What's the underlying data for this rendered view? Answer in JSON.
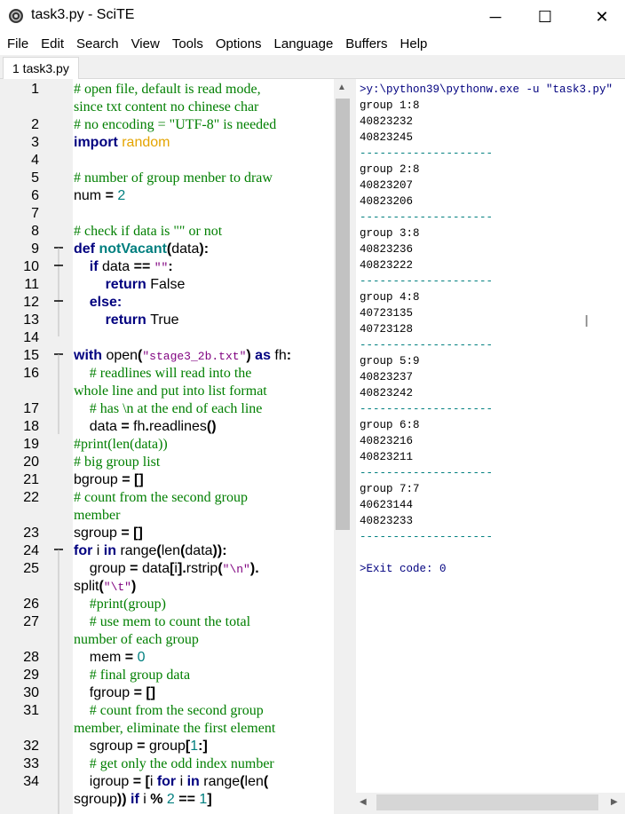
{
  "window": {
    "title": "task3.py - SciTE",
    "icon": "scite-app-icon",
    "controls": {
      "minimize": "─",
      "maximize": "☐",
      "close": "✕"
    }
  },
  "menu": [
    "File",
    "Edit",
    "Search",
    "View",
    "Tools",
    "Options",
    "Language",
    "Buffers",
    "Help"
  ],
  "tabs": [
    {
      "label": "1 task3.py",
      "active": true
    }
  ],
  "editor": {
    "line_numbers": [
      "1",
      "2",
      "3",
      "4",
      "5",
      "6",
      "7",
      "8",
      "9",
      "10",
      "11",
      "12",
      "13",
      "14",
      "15",
      "16",
      "17",
      "18",
      "19",
      "20",
      "21",
      "22",
      "23",
      "24",
      "25",
      "26",
      "27",
      "28",
      "29",
      "30",
      "31",
      "32",
      "33",
      "34"
    ],
    "lines": [
      [
        [
          "cm",
          "# open file, default is read mode,"
        ]
      ],
      [
        [
          "cm",
          "since txt content no chinese char"
        ]
      ],
      [
        [
          "cm",
          "# no encoding = \"UTF-8\" is needed"
        ]
      ],
      [
        [
          "kw",
          "import "
        ],
        [
          "imp",
          "random"
        ]
      ],
      [],
      [
        [
          "cm",
          "# number of group menber to draw"
        ]
      ],
      [
        [
          "id",
          "num "
        ],
        [
          "op",
          "= "
        ],
        [
          "num",
          "2"
        ]
      ],
      [],
      [
        [
          "cm",
          "# check if data is \"\" or not"
        ]
      ],
      [
        [
          "kw",
          "def "
        ],
        [
          "fn",
          "notVacant"
        ],
        [
          "op",
          "("
        ],
        [
          "id",
          "data"
        ],
        [
          "op",
          "):"
        ]
      ],
      [
        [
          "id",
          "    "
        ],
        [
          "kw",
          "if "
        ],
        [
          "id",
          "data "
        ],
        [
          "op",
          "== "
        ],
        [
          "str",
          "\"\""
        ],
        [
          "op",
          ":"
        ]
      ],
      [
        [
          "id",
          "        "
        ],
        [
          "kw",
          "return "
        ],
        [
          "id",
          "False"
        ]
      ],
      [
        [
          "id",
          "    "
        ],
        [
          "kw",
          "else:"
        ]
      ],
      [
        [
          "id",
          "        "
        ],
        [
          "kw",
          "return "
        ],
        [
          "id",
          "True"
        ]
      ],
      [],
      [
        [
          "kw",
          "with "
        ],
        [
          "id",
          "open"
        ],
        [
          "op",
          "("
        ],
        [
          "str",
          "\"stage3_2b.txt\""
        ],
        [
          "op",
          ") "
        ],
        [
          "kw",
          "as "
        ],
        [
          "id",
          "fh"
        ],
        [
          "op",
          ":"
        ]
      ],
      [
        [
          "id",
          "    "
        ],
        [
          "cm",
          "# readlines will read into the"
        ]
      ],
      [
        [
          "cm",
          "whole line and put into list format"
        ]
      ],
      [
        [
          "id",
          "    "
        ],
        [
          "cm",
          "# has \\n at the end of each line"
        ]
      ],
      [
        [
          "id",
          "    data "
        ],
        [
          "op",
          "= "
        ],
        [
          "id",
          "fh"
        ],
        [
          "op",
          "."
        ],
        [
          "id",
          "readlines"
        ],
        [
          "op",
          "()"
        ]
      ],
      [
        [
          "cm",
          "#print(len(data))"
        ]
      ],
      [
        [
          "cm",
          "# big group list"
        ]
      ],
      [
        [
          "id",
          "bgroup "
        ],
        [
          "op",
          "= []"
        ]
      ],
      [
        [
          "cm",
          "# count from the second group"
        ]
      ],
      [
        [
          "cm",
          "member"
        ]
      ],
      [
        [
          "id",
          "sgroup "
        ],
        [
          "op",
          "= []"
        ]
      ],
      [
        [
          "kw",
          "for "
        ],
        [
          "id",
          "i "
        ],
        [
          "kw",
          "in "
        ],
        [
          "id",
          "range"
        ],
        [
          "op",
          "("
        ],
        [
          "id",
          "len"
        ],
        [
          "op",
          "("
        ],
        [
          "id",
          "data"
        ],
        [
          "op",
          "))"
        ],
        [
          "op",
          ":"
        ]
      ],
      [
        [
          "id",
          "    group "
        ],
        [
          "op",
          "= "
        ],
        [
          "id",
          "data"
        ],
        [
          "op",
          "["
        ],
        [
          "id",
          "i"
        ],
        [
          "op",
          "]."
        ],
        [
          "id",
          "rstrip"
        ],
        [
          "op",
          "("
        ],
        [
          "str",
          "\"\\n\""
        ],
        [
          "op",
          ")."
        ]
      ],
      [
        [
          "id",
          "split"
        ],
        [
          "op",
          "("
        ],
        [
          "str",
          "\"\\t\""
        ],
        [
          "op",
          ")"
        ]
      ],
      [
        [
          "id",
          "    "
        ],
        [
          "cm",
          "#print(group)"
        ]
      ],
      [
        [
          "id",
          "    "
        ],
        [
          "cm",
          "# use mem to count the total"
        ]
      ],
      [
        [
          "cm",
          "number of each group"
        ]
      ],
      [
        [
          "id",
          "    mem "
        ],
        [
          "op",
          "= "
        ],
        [
          "num",
          "0"
        ]
      ],
      [
        [
          "id",
          "    "
        ],
        [
          "cm",
          "# final group data"
        ]
      ],
      [
        [
          "id",
          "    fgroup "
        ],
        [
          "op",
          "= []"
        ]
      ],
      [
        [
          "id",
          "    "
        ],
        [
          "cm",
          "# count from the second group"
        ]
      ],
      [
        [
          "cm",
          "member, eliminate the first element"
        ]
      ],
      [
        [
          "id",
          "    sgroup "
        ],
        [
          "op",
          "= "
        ],
        [
          "id",
          "group"
        ],
        [
          "op",
          "["
        ],
        [
          "num",
          "1"
        ],
        [
          "op",
          ":]"
        ]
      ],
      [
        [
          "id",
          "    "
        ],
        [
          "cm",
          "# get only the odd index number"
        ]
      ],
      [
        [
          "id",
          "    igroup "
        ],
        [
          "op",
          "= ["
        ],
        [
          "id",
          "i "
        ],
        [
          "kw",
          "for "
        ],
        [
          "id",
          "i "
        ],
        [
          "kw",
          "in "
        ],
        [
          "id",
          "range"
        ],
        [
          "op",
          "("
        ],
        [
          "id",
          "len"
        ],
        [
          "op",
          "("
        ]
      ],
      [
        [
          "id",
          "sgroup"
        ],
        [
          "op",
          "))"
        ],
        [
          "kw",
          " if "
        ],
        [
          "id",
          "i "
        ],
        [
          "op",
          "% "
        ],
        [
          "num",
          "2 "
        ],
        [
          "op",
          "== "
        ],
        [
          "num",
          "1"
        ],
        [
          "op",
          "]"
        ]
      ]
    ]
  },
  "output": {
    "lines": [
      [
        "cmd",
        ">y:\\python39\\pythonw.exe -u \"task3.py\""
      ],
      [
        "out",
        "group 1:8"
      ],
      [
        "out",
        "40823232"
      ],
      [
        "out",
        "40823245"
      ],
      [
        "sep",
        "--------------------"
      ],
      [
        "out",
        "group 2:8"
      ],
      [
        "out",
        "40823207"
      ],
      [
        "out",
        "40823206"
      ],
      [
        "sep",
        "--------------------"
      ],
      [
        "out",
        "group 3:8"
      ],
      [
        "out",
        "40823236"
      ],
      [
        "out",
        "40823222"
      ],
      [
        "sep",
        "--------------------"
      ],
      [
        "out",
        "group 4:8"
      ],
      [
        "out",
        "40723135"
      ],
      [
        "out",
        "40723128"
      ],
      [
        "sep",
        "--------------------"
      ],
      [
        "out",
        "group 5:9"
      ],
      [
        "out",
        "40823237"
      ],
      [
        "out",
        "40823242"
      ],
      [
        "sep",
        "--------------------"
      ],
      [
        "out",
        "group 6:8"
      ],
      [
        "out",
        "40823216"
      ],
      [
        "out",
        "40823211"
      ],
      [
        "sep",
        "--------------------"
      ],
      [
        "out",
        "group 7:7"
      ],
      [
        "out",
        "40623144"
      ],
      [
        "out",
        "40823233"
      ],
      [
        "sep",
        "--------------------"
      ],
      [
        "out",
        ""
      ],
      [
        "cmd",
        ">Exit code: 0"
      ]
    ]
  }
}
